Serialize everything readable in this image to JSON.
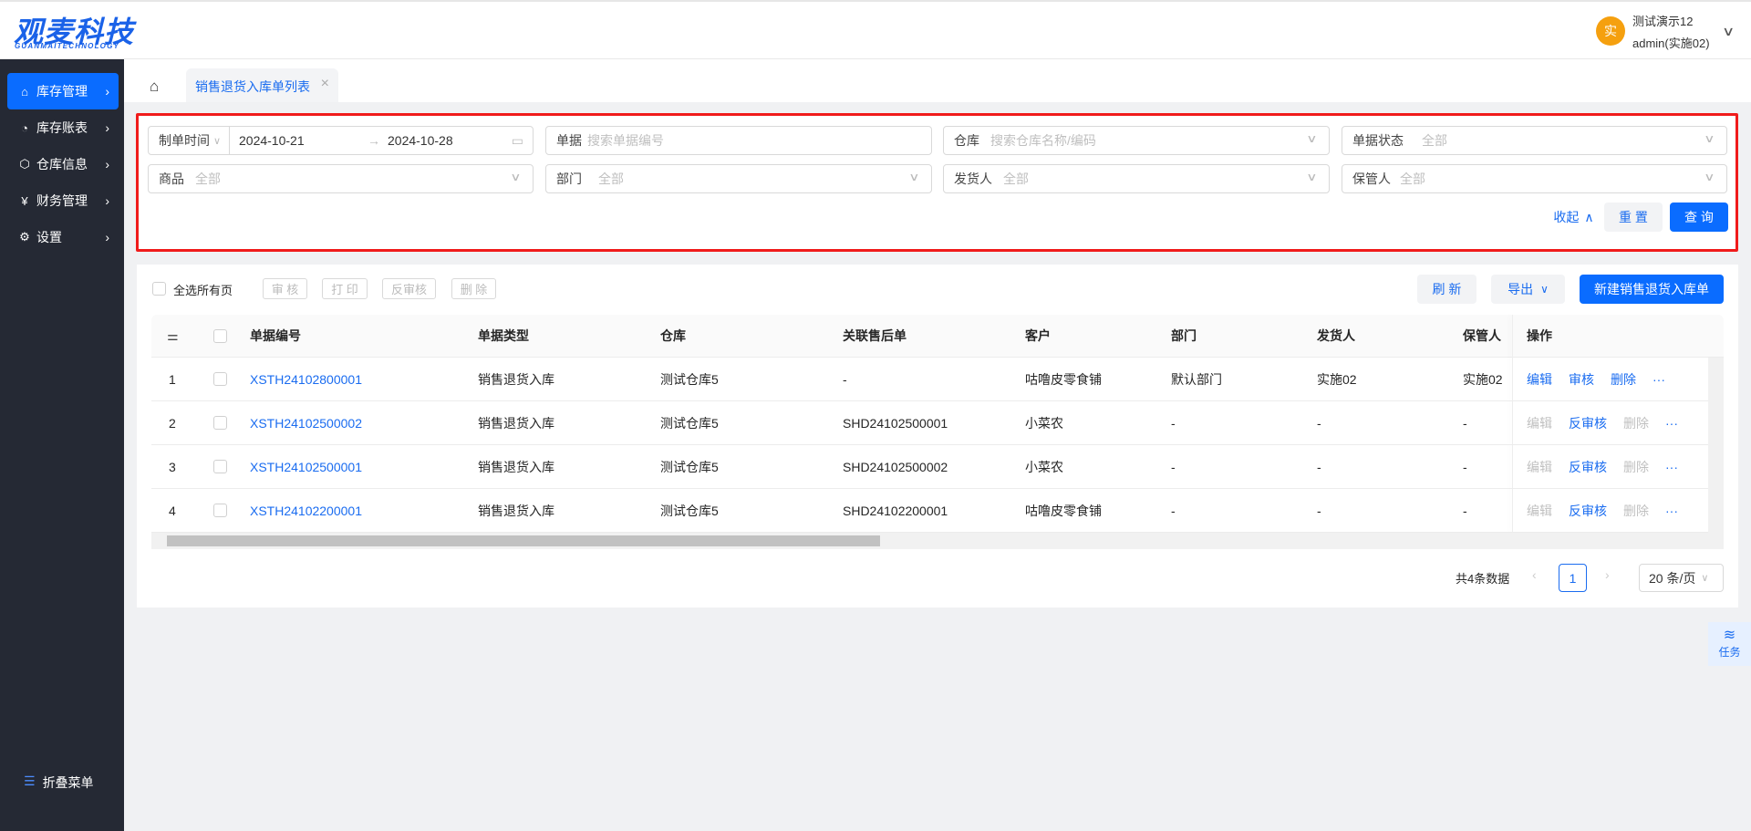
{
  "header": {
    "logo_cn": "观麦科技",
    "logo_en": "GUANMAITECHNOLOGY",
    "avatar_char": "实",
    "user_name": "测试演示12",
    "user_account": "admin(实施02)"
  },
  "sidebar": {
    "items": [
      {
        "label": "库存管理",
        "icon": "home-icon",
        "active": true
      },
      {
        "label": "库存账表",
        "icon": "pie-chart-icon"
      },
      {
        "label": "仓库信息",
        "icon": "box-icon"
      },
      {
        "label": "财务管理",
        "icon": "finance-icon"
      },
      {
        "label": "设置",
        "icon": "gear-icon"
      }
    ],
    "collapse_label": "折叠菜单"
  },
  "tabs": [
    {
      "label": "销售退货入库单列表",
      "active": true
    }
  ],
  "filter": {
    "date_type": "制单时间",
    "date_start": "2024-10-21",
    "date_end": "2024-10-28",
    "doc_label": "单据",
    "doc_placeholder": "搜索单据编号",
    "warehouse_label": "仓库",
    "warehouse_placeholder": "搜索仓库名称/编码",
    "status_label": "单据状态",
    "status_value": "全部",
    "product_label": "商品",
    "product_value": "全部",
    "dept_label": "部门",
    "dept_value": "全部",
    "shipper_label": "发货人",
    "shipper_value": "全部",
    "keeper_label": "保管人",
    "keeper_value": "全部",
    "collapse": "收起",
    "reset": "重 置",
    "query": "查 询"
  },
  "toolbar": {
    "select_all": "全选所有页",
    "approve": "审 核",
    "print": "打 印",
    "unapprove": "反审核",
    "delete": "删 除",
    "refresh": "刷 新",
    "export": "导出",
    "create": "新建销售退货入库单"
  },
  "table": {
    "columns": [
      "单据编号",
      "单据类型",
      "仓库",
      "关联售后单",
      "客户",
      "部门",
      "发货人",
      "保管人",
      "操作"
    ],
    "rows": [
      {
        "idx": "1",
        "no": "XSTH24102800001",
        "type": "销售退货入库",
        "wh": "测试仓库5",
        "rel": "-",
        "cust": "咕噜皮零食铺",
        "dept": "默认部门",
        "shipper": "实施02",
        "keeper": "实施02",
        "a1": "编辑",
        "a2": "审核",
        "a3": "删除",
        "more": "···"
      },
      {
        "idx": "2",
        "no": "XSTH24102500002",
        "type": "销售退货入库",
        "wh": "测试仓库5",
        "rel": "SHD24102500001",
        "cust": "小菜农",
        "dept": "-",
        "shipper": "-",
        "keeper": "-",
        "a1": "编辑",
        "a2": "反审核",
        "a3": "删除",
        "more": "···"
      },
      {
        "idx": "3",
        "no": "XSTH24102500001",
        "type": "销售退货入库",
        "wh": "测试仓库5",
        "rel": "SHD24102500002",
        "cust": "小菜农",
        "dept": "-",
        "shipper": "-",
        "keeper": "-",
        "a1": "编辑",
        "a2": "反审核",
        "a3": "删除",
        "more": "···"
      },
      {
        "idx": "4",
        "no": "XSTH24102200001",
        "type": "销售退货入库",
        "wh": "测试仓库5",
        "rel": "SHD24102200001",
        "cust": "咕噜皮零食铺",
        "dept": "-",
        "shipper": "-",
        "keeper": "-",
        "a1": "编辑",
        "a2": "反审核",
        "a3": "删除",
        "more": "···"
      }
    ]
  },
  "pagination": {
    "total": "共4条数据",
    "current": "1",
    "page_size": "20 条/页"
  },
  "float": {
    "task": "任务"
  },
  "colors": {
    "primary": "#0a6cff",
    "sidebar": "#252934",
    "highlight_border": "#f01b1b"
  }
}
